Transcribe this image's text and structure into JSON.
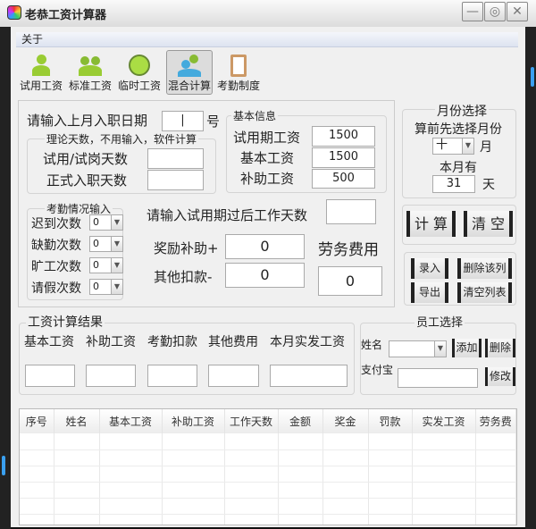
{
  "window": {
    "title": "老恭工资计算器",
    "minimize": "—",
    "settings": "◎",
    "close": "✕"
  },
  "menu": {
    "about": "关于"
  },
  "toolbar": [
    {
      "label": "试用工资"
    },
    {
      "label": "标准工资"
    },
    {
      "label": "临时工资"
    },
    {
      "label": "混合计算",
      "selected": true
    },
    {
      "label": "考勤制度"
    }
  ],
  "entry": {
    "label": "请输入上月入职日期",
    "value": "|",
    "suffix": "号"
  },
  "theory": {
    "title": "理论天数，不用输入，软件计算",
    "trial_label": "试用/试岗天数",
    "trial_value": "",
    "formal_label": "正式入职天数",
    "formal_value": ""
  },
  "basic": {
    "title": "基本信息",
    "rows": [
      {
        "label": "试用期工资",
        "value": "1500"
      },
      {
        "label": "基本工资",
        "value": "1500"
      },
      {
        "label": "补助工资",
        "value": "500"
      }
    ]
  },
  "attendance": {
    "title": "考勤情况输入",
    "rows": [
      {
        "label": "迟到次数",
        "value": "0"
      },
      {
        "label": "缺勤次数",
        "value": "0"
      },
      {
        "label": "旷工次数",
        "value": "0"
      },
      {
        "label": "请假次数",
        "value": "0"
      }
    ]
  },
  "after_trial": {
    "label": "请输入试用期过后工作天数",
    "value": ""
  },
  "bonus": {
    "label": "奖励补助+",
    "value": "0"
  },
  "deduct": {
    "label": "其他扣款-",
    "value": "0"
  },
  "labor": {
    "label": "劳务费用",
    "value": "0"
  },
  "month": {
    "title": "月份选择",
    "hint": "算前先选择月份",
    "value": "十",
    "unit": "月",
    "days_label": "本月有",
    "days": "31",
    "days_unit": "天"
  },
  "actions": {
    "calc": "计 算",
    "clear": "清 空",
    "record": "录入",
    "delete_col": "删除该列",
    "export": "导出",
    "clear_list": "清空列表"
  },
  "result": {
    "title": "工资计算结果",
    "cols": [
      {
        "label": "基本工资",
        "value": ""
      },
      {
        "label": "补助工资",
        "value": ""
      },
      {
        "label": "考勤扣款",
        "value": ""
      },
      {
        "label": "其他费用",
        "value": ""
      },
      {
        "label": "本月实发工资",
        "value": ""
      }
    ]
  },
  "employee": {
    "title": "员工选择",
    "name_label": "姓名",
    "name_value": "",
    "add": "添加",
    "delete": "删除",
    "alipay_label": "支付宝",
    "alipay_value": "",
    "modify": "修改"
  },
  "table": {
    "headers": [
      "序号",
      "姓名",
      "基本工资",
      "补助工资",
      "工作天数",
      "金额",
      "奖金",
      "罚款",
      "实发工资",
      "劳务费"
    ]
  }
}
